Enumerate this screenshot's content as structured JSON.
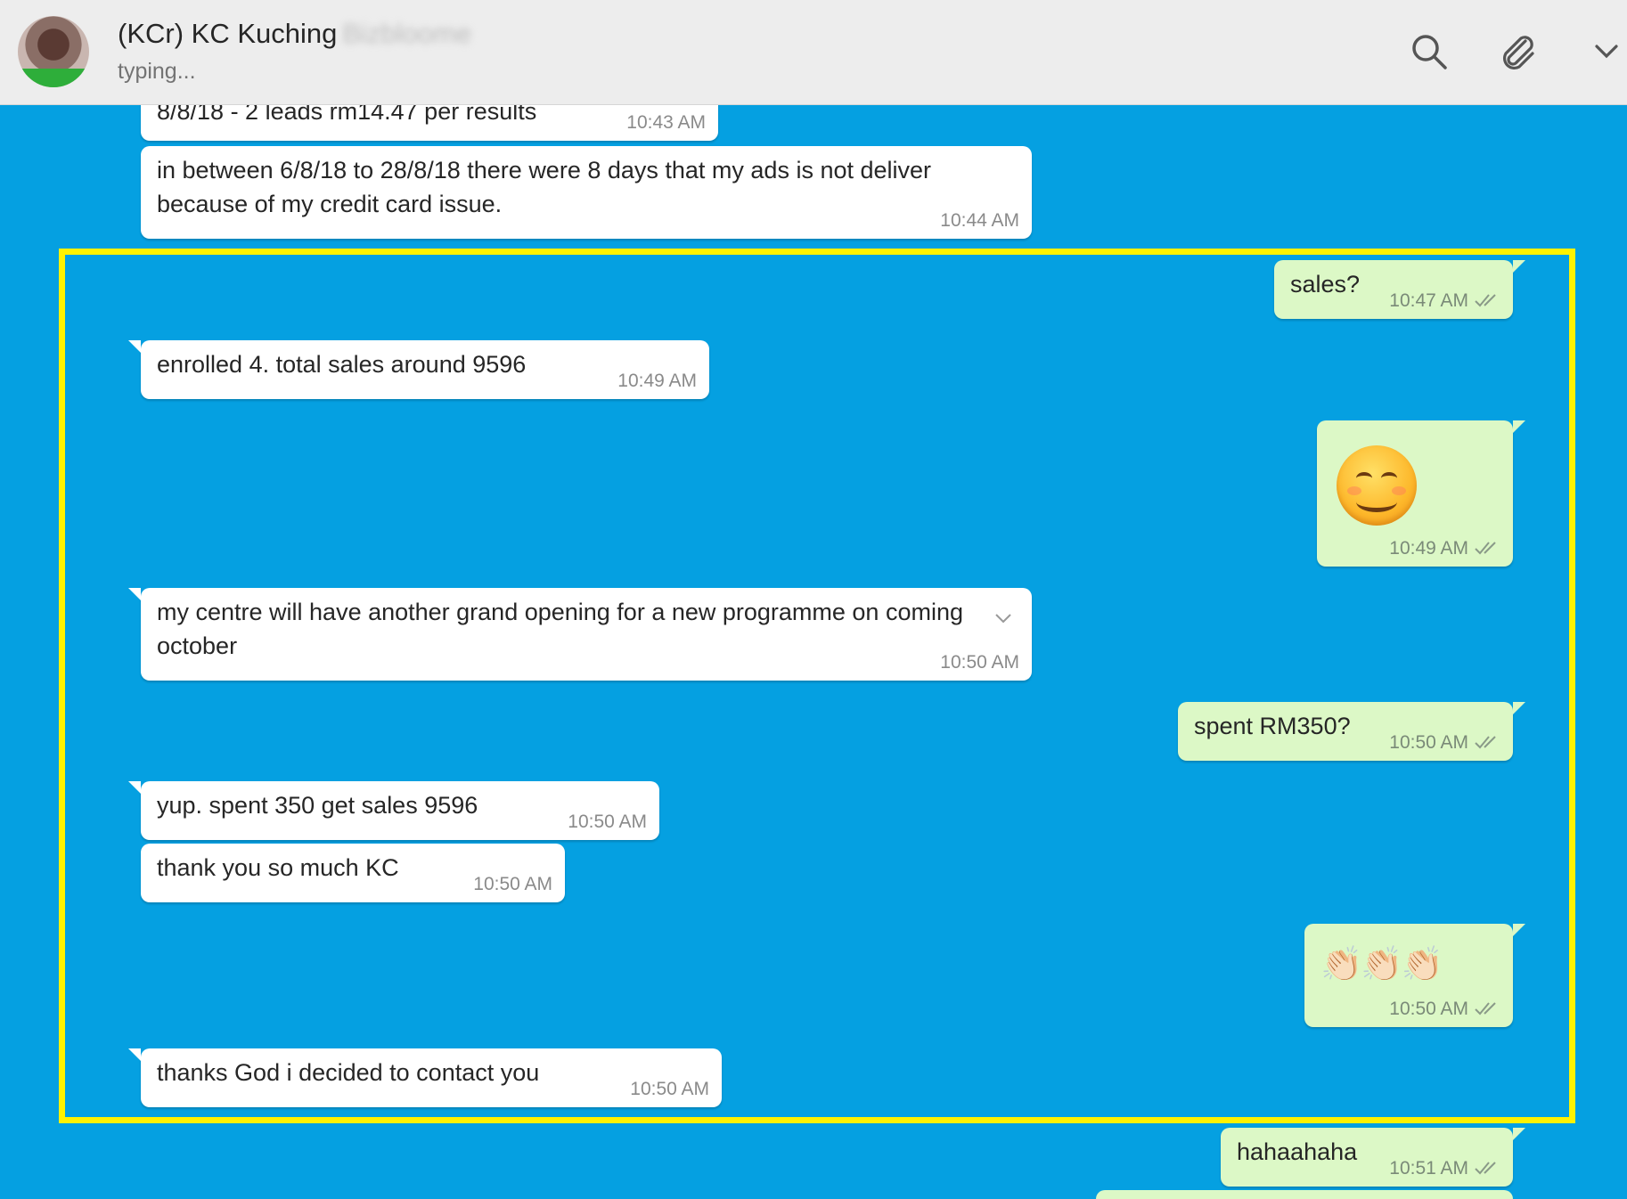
{
  "header": {
    "title": "(KCr) KC Kuching",
    "title_blurred": "Bizbloome",
    "subtitle": "typing...",
    "icons": [
      "search-icon",
      "paperclip-icon",
      "chevron-down-icon"
    ]
  },
  "colors": {
    "chat_background": "#05a0e1",
    "incoming_bubble": "#ffffff",
    "outgoing_bubble": "#dcf8c6",
    "highlight_border": "#fff200",
    "header_background": "#ededed"
  },
  "messages": [
    {
      "direction": "in",
      "text": "8/8/18 - 2 leads rm14.47 per results",
      "time": "10:43 AM"
    },
    {
      "direction": "in",
      "text": "in between 6/8/18 to 28/8/18 there were 8 days that my ads is not deliver because of my credit card issue.",
      "time": "10:44 AM"
    },
    {
      "direction": "out",
      "text": "sales?",
      "time": "10:47 AM"
    },
    {
      "direction": "in",
      "text": "enrolled 4. total sales around 9596",
      "time": "10:49 AM"
    },
    {
      "direction": "out",
      "text": "😊",
      "time": "10:49 AM"
    },
    {
      "direction": "in",
      "text": "my centre will have another grand opening for a new programme on coming october",
      "time": "10:50 AM"
    },
    {
      "direction": "out",
      "text": "spent RM350?",
      "time": "10:50 AM"
    },
    {
      "direction": "in",
      "text": "yup. spent 350 get sales 9596",
      "time": "10:50 AM"
    },
    {
      "direction": "in",
      "text": "thank you so much KC",
      "time": "10:50 AM"
    },
    {
      "direction": "out",
      "text": "👏🏻👏🏻👏🏻",
      "time": "10:50 AM"
    },
    {
      "direction": "in",
      "text": "thanks God i decided to contact you",
      "time": "10:50 AM"
    },
    {
      "direction": "out",
      "text": "hahaahaha",
      "time": "10:51 AM"
    }
  ]
}
